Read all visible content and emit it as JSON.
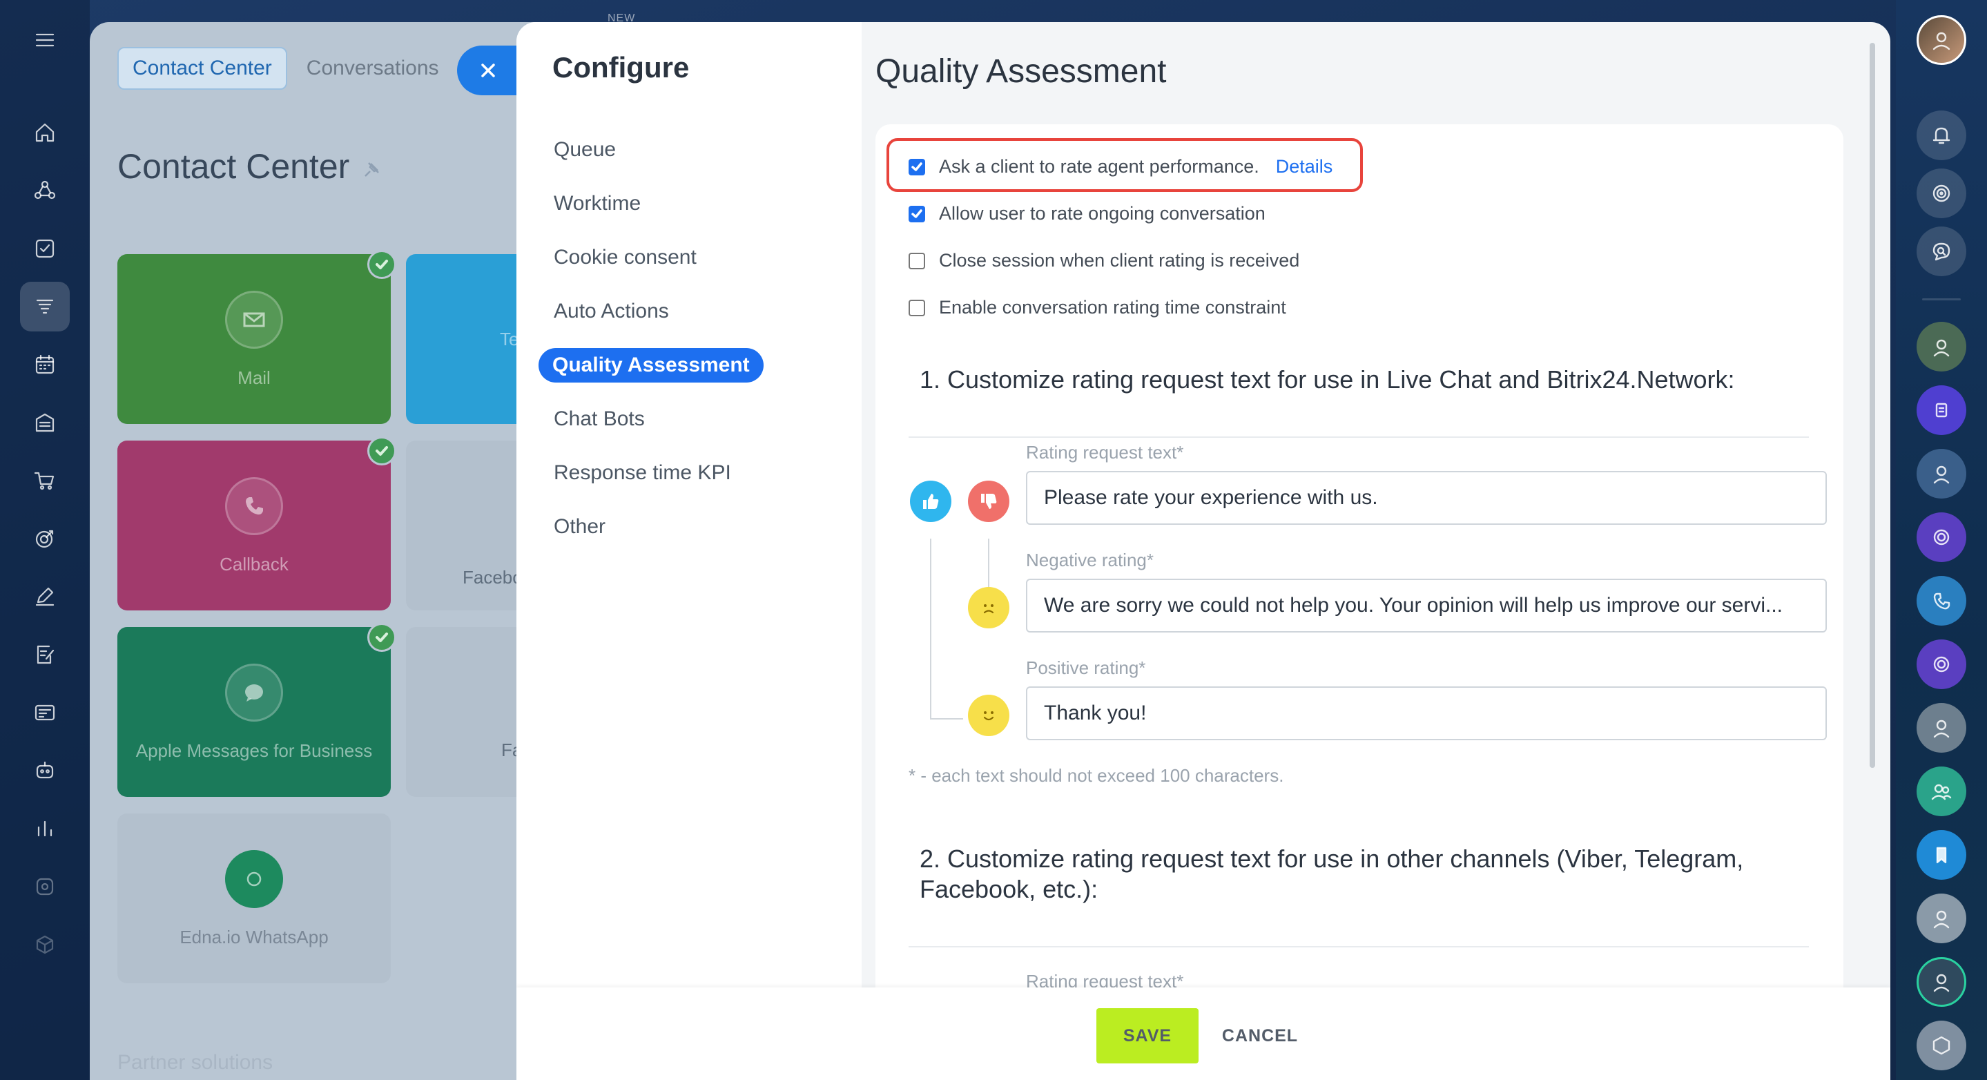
{
  "top_badge": "NEW",
  "background": {
    "tabs": {
      "active": "Contact Center",
      "other": "Conversations"
    },
    "title": "Contact Center",
    "tiles": [
      {
        "label": "Mail",
        "color": "#3f8a3f",
        "checked": true,
        "icon": "mail-icon"
      },
      {
        "label": "Te",
        "color": "#2a9fd6",
        "checked": false,
        "icon": ""
      },
      {
        "label": "Callback",
        "color": "#a13a6c",
        "checked": true,
        "icon": "phone-icon"
      },
      {
        "label": "Facebo",
        "color": "",
        "checked": false,
        "icon": ""
      },
      {
        "label": "Apple Messages for Business",
        "color": "#1b7a5a",
        "checked": true,
        "icon": "chat-bubble-icon"
      },
      {
        "label": "Fa",
        "color": "",
        "checked": false,
        "icon": ""
      },
      {
        "label": "Edna.io WhatsApp",
        "color": "",
        "checked": false,
        "icon": "edna-icon"
      }
    ],
    "footer_text": "Partner solutions"
  },
  "configure": {
    "title": "Configure",
    "nav": [
      {
        "label": "Queue",
        "active": false
      },
      {
        "label": "Worktime",
        "active": false
      },
      {
        "label": "Cookie consent",
        "active": false
      },
      {
        "label": "Auto Actions",
        "active": false
      },
      {
        "label": "Quality Assessment",
        "active": true
      },
      {
        "label": "Chat Bots",
        "active": false
      },
      {
        "label": "Response time KPI",
        "active": false
      },
      {
        "label": "Other",
        "active": false
      }
    ]
  },
  "quality": {
    "title": "Quality Assessment",
    "options": [
      {
        "label": "Ask a client to rate agent performance.",
        "link": "Details",
        "checked": true
      },
      {
        "label": "Allow user to rate ongoing conversation",
        "checked": true
      },
      {
        "label": "Close session when client rating is received",
        "checked": false
      },
      {
        "label": "Enable conversation rating time constraint",
        "checked": false
      }
    ],
    "section1_title": "1. Customize rating request text for use in Live Chat and Bitrix24.Network:",
    "fields1": {
      "request_label": "Rating request text*",
      "request_value": "Please rate your experience with us.",
      "negative_label": "Negative rating*",
      "negative_value": "We are sorry we could not help you. Your opinion will help us improve our servi...",
      "positive_label": "Positive rating*",
      "positive_value": "Thank you!"
    },
    "note": "* - each text should not exceed 100 characters.",
    "section2_title": "2. Customize rating request text for use in other channels (Viber, Telegram, Facebook, etc.):",
    "fields2": {
      "request_label": "Rating request text*"
    }
  },
  "buttons": {
    "save": "SAVE",
    "cancel": "CANCEL"
  },
  "colors": {
    "accent": "#1d6ff0",
    "save": "#bbed21",
    "highlight": "#e8443c",
    "like": "#2fb6ee",
    "dislike": "#f0706a",
    "smiley": "#f7df4a"
  }
}
